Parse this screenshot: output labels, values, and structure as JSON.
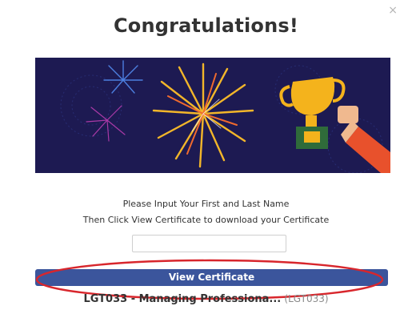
{
  "dialog": {
    "close_glyph": "×",
    "title": "Congratulations!"
  },
  "instructions": {
    "line1": "Please Input Your First and Last Name",
    "line2": "Then Click View Certificate to download your Certificate"
  },
  "name_input": {
    "value": "",
    "placeholder": ""
  },
  "view_button": {
    "label": "View Certificate"
  },
  "course": {
    "name": "LGT033 - Managing Professiona...",
    "code": "(LGT033)"
  },
  "colors": {
    "banner_bg": "#1d1a52",
    "button_bg": "#3b559c",
    "highlight_ellipse": "#d8262c",
    "trophy_gold": "#f4b31c",
    "sleeve_red": "#e8512c"
  },
  "icons": {
    "close": "close-icon",
    "trophy": "trophy-icon",
    "fireworks": "fireworks-illustration"
  }
}
